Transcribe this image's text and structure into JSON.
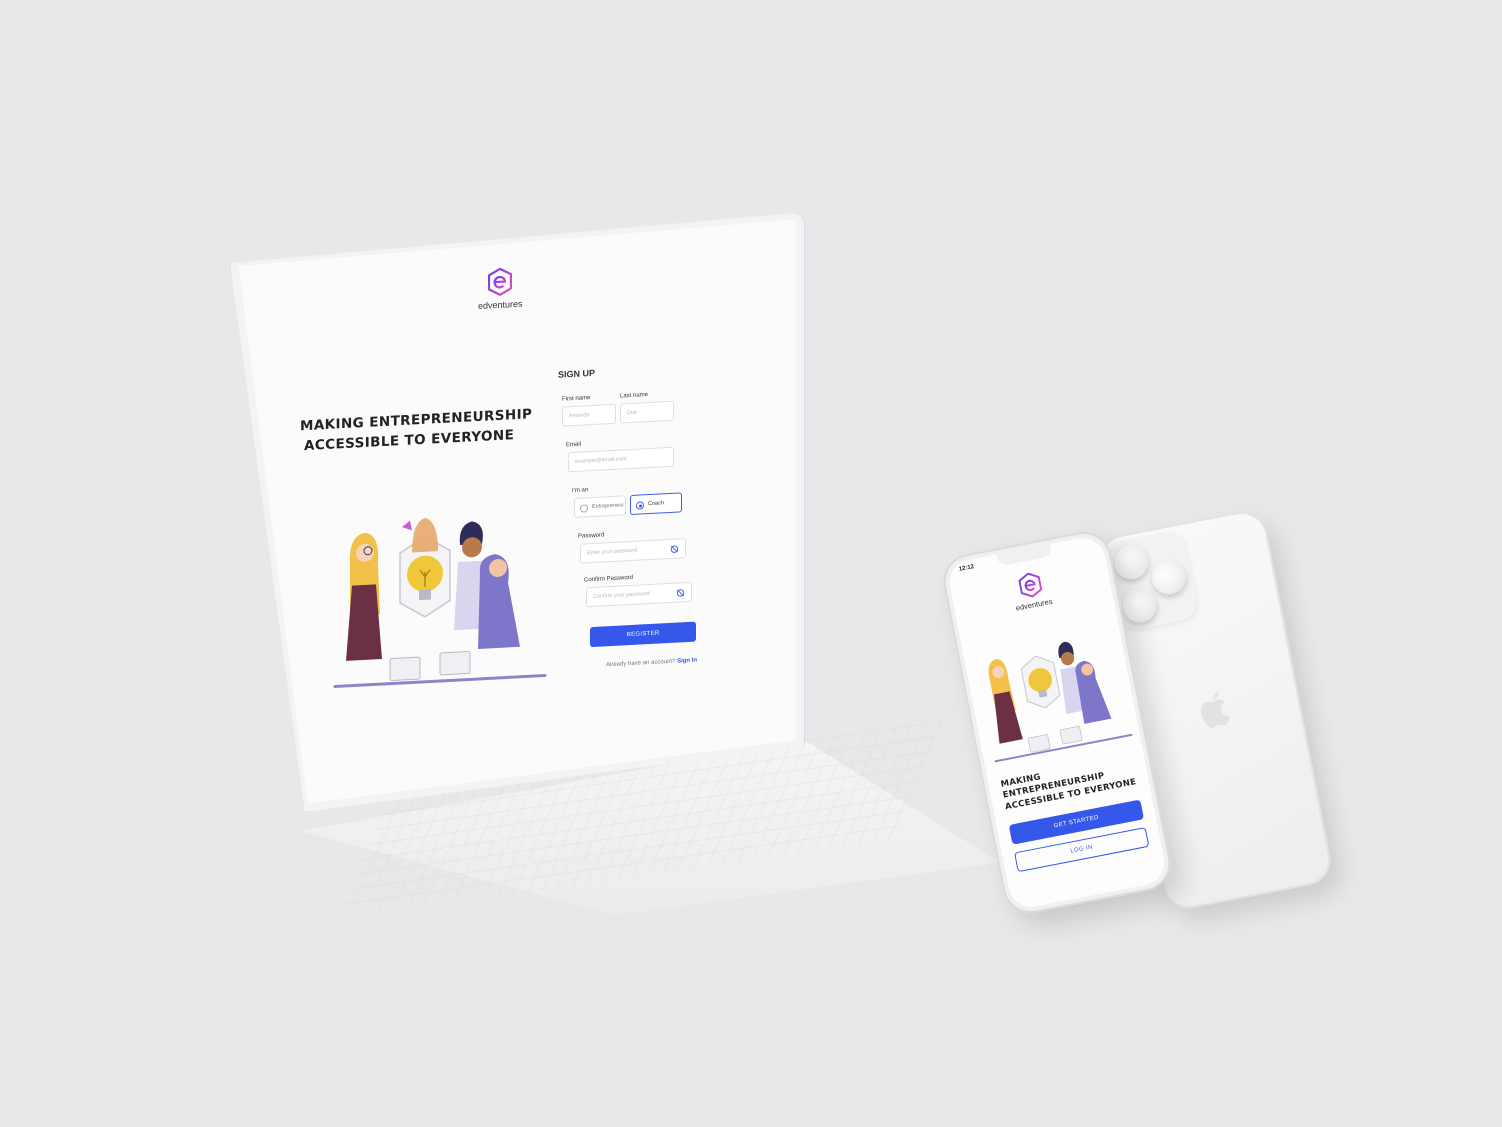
{
  "brand": {
    "name": "edventures",
    "accent": "#3557ea",
    "logo_gradient": [
      "#7b3fe4",
      "#e64dc0"
    ]
  },
  "desktop": {
    "headline_line1": "MAKING ENTREPRENEURSHIP",
    "headline_line2": "ACCESSIBLE TO EVERYONE",
    "form": {
      "title": "SIGN UP",
      "first_name_label": "First name",
      "first_name_placeholder": "Amanda",
      "last_name_label": "Last name",
      "last_name_placeholder": "Doe",
      "email_label": "Email",
      "email_placeholder": "example@email.com",
      "role_label": "I'm an",
      "role_options": [
        "Entrepreneur",
        "Coach"
      ],
      "role_selected": "Coach",
      "password_label": "Password",
      "password_placeholder": "Enter your password",
      "confirm_label": "Confirm Password",
      "confirm_placeholder": "Confirm your password",
      "register_label": "REGISTER",
      "signin_prompt": "Already have an account?",
      "signin_link": "Sign In"
    }
  },
  "mobile": {
    "status_time": "12:12",
    "headline_line1": "MAKING",
    "headline_line2": "ENTREPRENEURSHIP",
    "headline_line3": "ACCESSIBLE TO EVERYONE",
    "get_started_label": "GET STARTED",
    "login_label": "LOG IN"
  }
}
